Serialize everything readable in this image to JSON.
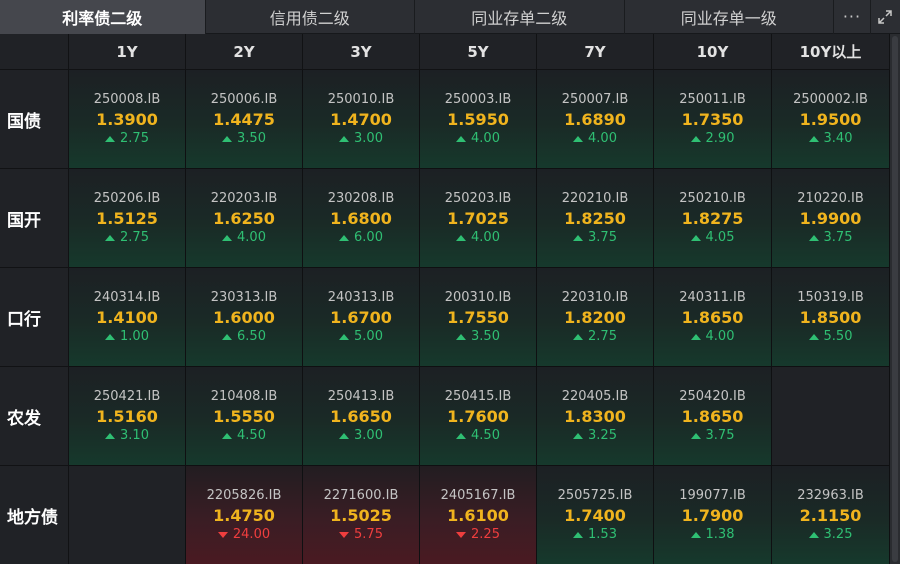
{
  "tabs": [
    {
      "label": "利率债二级",
      "active": true
    },
    {
      "label": "信用债二级",
      "active": false
    },
    {
      "label": "同业存单二级",
      "active": false
    },
    {
      "label": "同业存单一级",
      "active": false
    }
  ],
  "toolbar": {
    "more_label": "···",
    "more_icon": "more-dots-icon",
    "expand_icon": "expand-icon"
  },
  "colors": {
    "rate": "#f0b41e",
    "up": "#2fbf73",
    "down": "#ef3e3e",
    "active_tab": "#45474d"
  },
  "columns": [
    "1Y",
    "2Y",
    "3Y",
    "5Y",
    "7Y",
    "10Y",
    "10Y以上"
  ],
  "rows": [
    {
      "label": "国债",
      "cells": [
        {
          "code": "250008.IB",
          "rate": "1.3900",
          "change": "2.75",
          "dir": "up"
        },
        {
          "code": "250006.IB",
          "rate": "1.4475",
          "change": "3.50",
          "dir": "up"
        },
        {
          "code": "250010.IB",
          "rate": "1.4700",
          "change": "3.00",
          "dir": "up"
        },
        {
          "code": "250003.IB",
          "rate": "1.5950",
          "change": "4.00",
          "dir": "up"
        },
        {
          "code": "250007.IB",
          "rate": "1.6890",
          "change": "4.00",
          "dir": "up"
        },
        {
          "code": "250011.IB",
          "rate": "1.7350",
          "change": "2.90",
          "dir": "up"
        },
        {
          "code": "2500002.IB",
          "rate": "1.9500",
          "change": "3.40",
          "dir": "up"
        }
      ]
    },
    {
      "label": "国开",
      "cells": [
        {
          "code": "250206.IB",
          "rate": "1.5125",
          "change": "2.75",
          "dir": "up"
        },
        {
          "code": "220203.IB",
          "rate": "1.6250",
          "change": "4.00",
          "dir": "up"
        },
        {
          "code": "230208.IB",
          "rate": "1.6800",
          "change": "6.00",
          "dir": "up"
        },
        {
          "code": "250203.IB",
          "rate": "1.7025",
          "change": "4.00",
          "dir": "up"
        },
        {
          "code": "220210.IB",
          "rate": "1.8250",
          "change": "3.75",
          "dir": "up"
        },
        {
          "code": "250210.IB",
          "rate": "1.8275",
          "change": "4.05",
          "dir": "up"
        },
        {
          "code": "210220.IB",
          "rate": "1.9900",
          "change": "3.75",
          "dir": "up"
        }
      ]
    },
    {
      "label": "口行",
      "cells": [
        {
          "code": "240314.IB",
          "rate": "1.4100",
          "change": "1.00",
          "dir": "up"
        },
        {
          "code": "230313.IB",
          "rate": "1.6000",
          "change": "6.50",
          "dir": "up"
        },
        {
          "code": "240313.IB",
          "rate": "1.6700",
          "change": "5.00",
          "dir": "up"
        },
        {
          "code": "200310.IB",
          "rate": "1.7550",
          "change": "3.50",
          "dir": "up"
        },
        {
          "code": "220310.IB",
          "rate": "1.8200",
          "change": "2.75",
          "dir": "up"
        },
        {
          "code": "240311.IB",
          "rate": "1.8650",
          "change": "4.00",
          "dir": "up"
        },
        {
          "code": "150319.IB",
          "rate": "1.8500",
          "change": "5.50",
          "dir": "up"
        }
      ]
    },
    {
      "label": "农发",
      "cells": [
        {
          "code": "250421.IB",
          "rate": "1.5160",
          "change": "3.10",
          "dir": "up"
        },
        {
          "code": "210408.IB",
          "rate": "1.5550",
          "change": "4.50",
          "dir": "up"
        },
        {
          "code": "250413.IB",
          "rate": "1.6650",
          "change": "3.00",
          "dir": "up"
        },
        {
          "code": "250415.IB",
          "rate": "1.7600",
          "change": "4.50",
          "dir": "up"
        },
        {
          "code": "220405.IB",
          "rate": "1.8300",
          "change": "3.25",
          "dir": "up"
        },
        {
          "code": "250420.IB",
          "rate": "1.8650",
          "change": "3.75",
          "dir": "up"
        },
        null
      ]
    },
    {
      "label": "地方债",
      "cells": [
        null,
        {
          "code": "2205826.IB",
          "rate": "1.4750",
          "change": "24.00",
          "dir": "down"
        },
        {
          "code": "2271600.IB",
          "rate": "1.5025",
          "change": "5.75",
          "dir": "down"
        },
        {
          "code": "2405167.IB",
          "rate": "1.6100",
          "change": "2.25",
          "dir": "down"
        },
        {
          "code": "2505725.IB",
          "rate": "1.7400",
          "change": "1.53",
          "dir": "up"
        },
        {
          "code": "199077.IB",
          "rate": "1.7900",
          "change": "1.38",
          "dir": "up"
        },
        {
          "code": "232963.IB",
          "rate": "2.1150",
          "change": "3.25",
          "dir": "up"
        }
      ]
    }
  ]
}
